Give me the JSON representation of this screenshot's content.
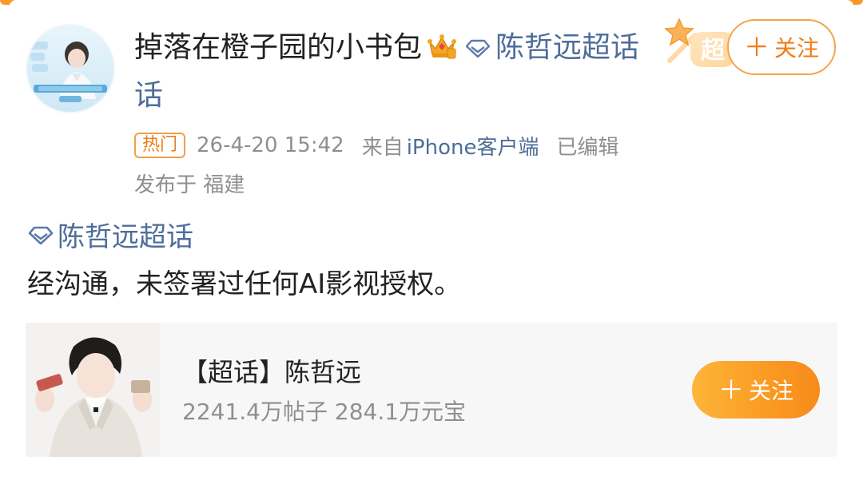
{
  "header": {
    "username": "掉落在橙子园的小书包",
    "topic_link": "陈哲远超话",
    "follow_label": "关注",
    "super_badge": "超"
  },
  "meta": {
    "hot_label": "热门",
    "time": "26-4-20 15:42",
    "from_label": "来自",
    "client": "iPhone客户端",
    "edited": "已编辑",
    "location": "发布于 福建"
  },
  "post": {
    "topic": "陈哲远超话",
    "text": "经沟通，未签署过任何AI影视授权。"
  },
  "card": {
    "title": "【超话】陈哲远",
    "stats": "2241.4万帖子 284.1万元宝",
    "follow_label": "关注"
  },
  "colors": {
    "accent_orange": "#f79a2c",
    "link_blue": "#4e6d99",
    "meta_gray": "#8f8f8f"
  },
  "icons": {
    "crown": "crown-icon",
    "diamond": "diamond-icon",
    "plus": "plus-icon"
  }
}
